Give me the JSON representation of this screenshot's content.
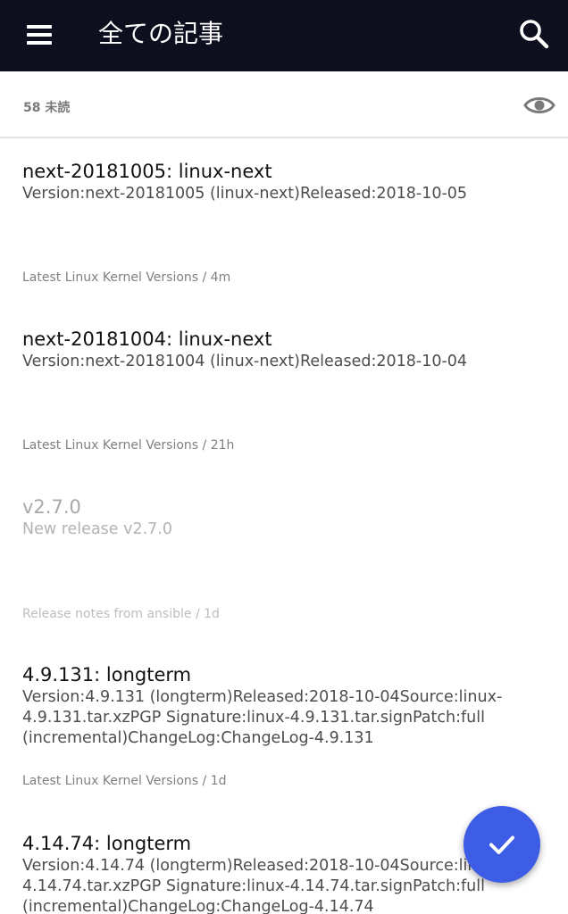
{
  "appbar": {
    "title": "全ての記事",
    "background": "#0e0f1e"
  },
  "unread": {
    "label": "58 未読"
  },
  "articles": [
    {
      "title": "next-20181005: linux-next",
      "excerpt": "Version:next-20181005 (linux-next)Released:2018-10-05",
      "meta": "Latest Linux Kernel Versions / 4m",
      "read": false
    },
    {
      "title": "next-20181004: linux-next",
      "excerpt": "Version:next-20181004 (linux-next)Released:2018-10-04",
      "meta": "Latest Linux Kernel Versions / 21h",
      "read": false
    },
    {
      "title": "v2.7.0",
      "excerpt": "New release v2.7.0",
      "meta": "Release notes from ansible / 1d",
      "read": true
    },
    {
      "title": "4.9.131: longterm",
      "excerpt": "Version:4.9.131 (longterm)Released:2018-10-04Source:linux-4.9.131.tar.xzPGP Signature:linux-4.9.131.tar.signPatch:full (incremental)ChangeLog:ChangeLog-4.9.131",
      "meta": "Latest Linux Kernel Versions / 1d",
      "read": false
    },
    {
      "title": "4.14.74: longterm",
      "excerpt": "Version:4.14.74 (longterm)Released:2018-10-04Source:linux-4.14.74.tar.xzPGP Signature:linux-4.14.74.tar.signPatch:full (incremental)ChangeLog:ChangeLog-4.14.74",
      "meta": "",
      "read": false
    }
  ],
  "fab": {
    "icon": "check-icon",
    "color": "#3d5de6"
  }
}
